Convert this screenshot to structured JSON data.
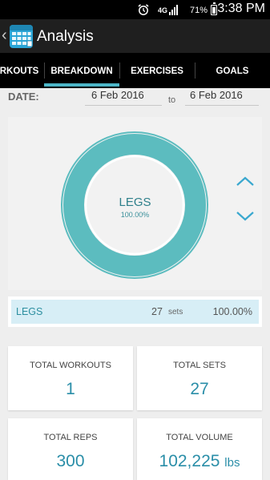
{
  "status_bar": {
    "network": "4G",
    "battery": "71%",
    "time": "3:38 PM"
  },
  "app_bar": {
    "title": "Analysis"
  },
  "tabs": [
    {
      "label": "WORKOUTS",
      "visible_text": "RKOUTS",
      "selected": false
    },
    {
      "label": "BREAKDOWN",
      "visible_text": "BREAKDOWN",
      "selected": true
    },
    {
      "label": "EXERCISES",
      "visible_text": "EXERCISES",
      "selected": false
    },
    {
      "label": "GOALS",
      "visible_text": "GOALS",
      "selected": false
    }
  ],
  "date_range": {
    "label": "DATE:",
    "from": "6 Feb 2016",
    "separator": "to",
    "to": "6 Feb 2016"
  },
  "donut": {
    "segment_name": "LEGS",
    "segment_percent": "100.00%",
    "segment_fraction": 1.0,
    "color": "#5cbcbf"
  },
  "breakdown_list": [
    {
      "name": "LEGS",
      "sets": "27",
      "sets_unit": "sets",
      "percent": "100.00%"
    }
  ],
  "stats": {
    "total_workouts": {
      "label": "TOTAL WORKOUTS",
      "value": "1"
    },
    "total_sets": {
      "label": "TOTAL SETS",
      "value": "27"
    },
    "total_reps": {
      "label": "TOTAL REPS",
      "value": "300"
    },
    "total_volume": {
      "label": "TOTAL VOLUME",
      "value": "102,225",
      "unit": "lbs"
    }
  },
  "colors": {
    "accent": "#4cb6c8",
    "donut": "#5cbcbf",
    "stat_value": "#2a8ea8",
    "legend_bg": "#d7eef6"
  },
  "icons": {
    "back": "chevron-left-icon",
    "app": "calendar-app-icon",
    "alarm": "alarm-icon",
    "signal": "signal-icon",
    "battery": "battery-icon",
    "arrow_up": "chevron-up-icon",
    "arrow_down": "chevron-down-icon"
  }
}
